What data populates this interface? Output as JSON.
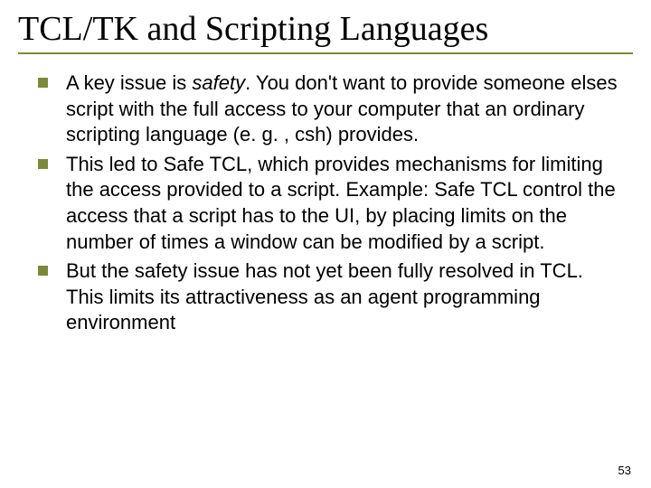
{
  "slide": {
    "title": "TCL/TK and Scripting Languages",
    "bullets": [
      {
        "pre": "A key issue is ",
        "em": "safety",
        "post": ". You don't want to provide someone elses script with the full access to your computer that an ordinary scripting language (e. g. , csh) provides."
      },
      {
        "pre": "This led to Safe TCL, which provides mechanisms for limiting the access provided to a script. Example: Safe TCL control the access that a script has to the UI, by placing limits on the number of times a window can be modified by a script.",
        "em": "",
        "post": ""
      },
      {
        "pre": "But the safety issue has not yet been fully resolved in TCL. This limits its attractiveness as an agent programming environment",
        "em": "",
        "post": ""
      }
    ],
    "page_number": "53"
  }
}
